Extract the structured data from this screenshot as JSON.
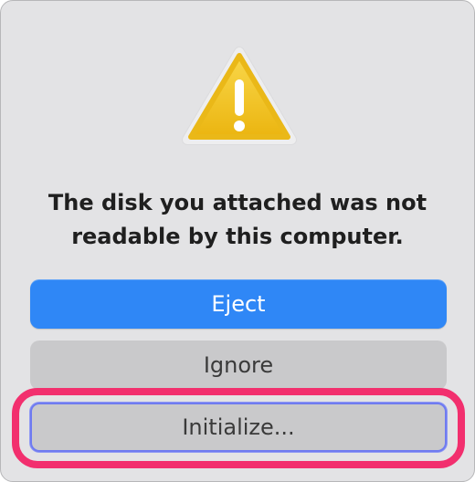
{
  "dialog": {
    "icon": "warning-triangle-icon",
    "message": "The disk you attached was not readable by this computer.",
    "buttons": {
      "eject_label": "Eject",
      "ignore_label": "Ignore",
      "initialize_label": "Initialize..."
    }
  },
  "colors": {
    "accent": "#2f87f6",
    "highlight": "#f22f6e",
    "warning": "#f3c319"
  }
}
